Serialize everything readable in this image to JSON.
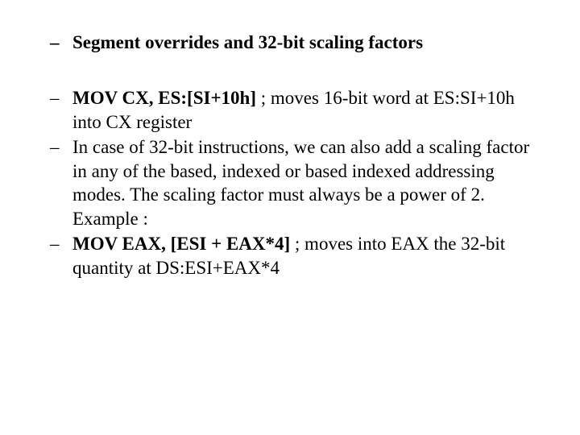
{
  "title": "Segment overrides and 32-bit scaling factors",
  "items": [
    {
      "bold": "MOV CX, ES:[SI+10h]",
      "text": "    ; moves 16-bit word at ES:SI+10h into CX register"
    },
    {
      "bold": "",
      "text": "In case of 32-bit instructions, we can also add a scaling factor in any of the based, indexed or based indexed addressing modes. The scaling factor must always be a power of 2. Example :"
    },
    {
      "bold": "MOV EAX, [ESI + EAX*4]",
      "text": "    ; moves into EAX the 32-bit quantity at DS:ESI+EAX*4"
    }
  ],
  "dash": "–"
}
